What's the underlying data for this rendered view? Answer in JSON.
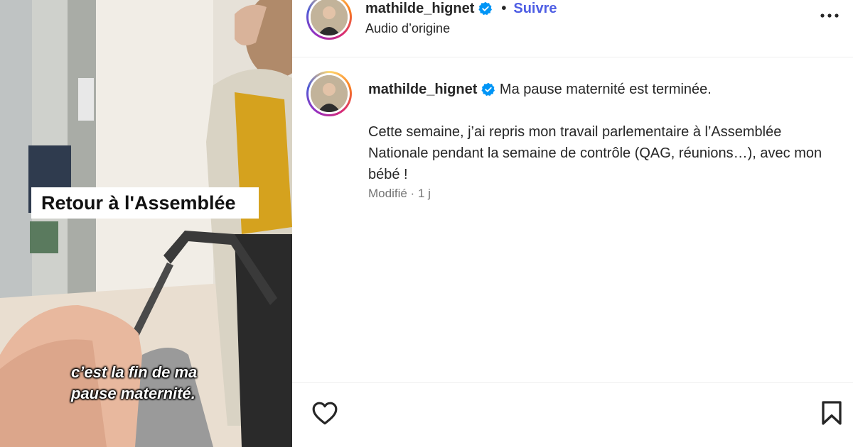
{
  "post": {
    "username": "mathilde_hignet",
    "separator": "•",
    "follow_label": "Suivre",
    "audio_label": "Audio d’origine"
  },
  "video": {
    "overlay_title": "Retour à l'Assemblée",
    "caption": "c’est la fin de ma\npause maternité."
  },
  "comment": {
    "username": "mathilde_hignet",
    "first_line": "Ma pause maternité est terminée.",
    "body": "\nCette semaine, j’ai repris mon travail parlementaire à l’Assemblée Nationale pendant la semaine de contrôle (QAG, réunions…), avec mon bébé !",
    "status": "Modifié",
    "meta_sep": "·",
    "age": "1 j"
  },
  "icons": {
    "verified": "verified-badge-icon",
    "more": "more-options-icon",
    "like": "heart-icon",
    "save": "bookmark-icon"
  },
  "colors": {
    "follow": "#4e5ee4",
    "verified": "#0095f6",
    "meta": "#737373"
  }
}
